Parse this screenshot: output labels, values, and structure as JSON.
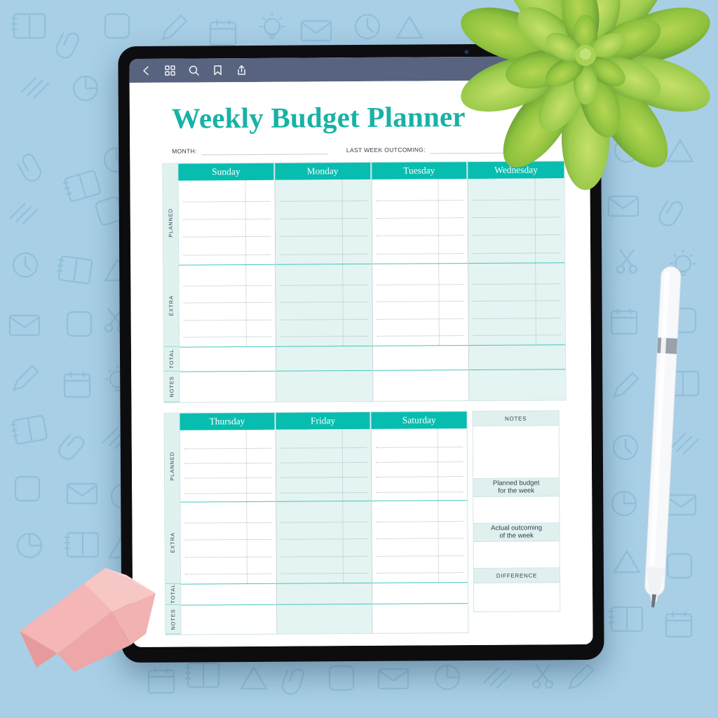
{
  "device": {
    "type": "tablet",
    "toolbar": {
      "icons": [
        {
          "name": "back-icon",
          "label": "Back"
        },
        {
          "name": "grid-icon",
          "label": "Thumbnails"
        },
        {
          "name": "search-icon",
          "label": "Search"
        },
        {
          "name": "bookmark-icon",
          "label": "Bookmark"
        },
        {
          "name": "share-icon",
          "label": "Share"
        },
        {
          "name": "undo-icon",
          "label": "Undo"
        }
      ],
      "background_color": "#58637F"
    }
  },
  "document": {
    "title": "Weekly Budget Planner",
    "title_color": "#17B2A6",
    "fields": [
      {
        "name": "month",
        "label": "MONTH:",
        "value": ""
      },
      {
        "name": "last-week-outcoming",
        "label": "LAST WEEK OUTCOMING:",
        "value": ""
      }
    ],
    "colors": {
      "header_teal": "#07BDAF",
      "tint_teal": "#E4F4F2",
      "label_band": "#DFF0EE",
      "rule_teal": "#45C6BD",
      "border": "#CFE3E3"
    },
    "row_labels": [
      "PLANNED",
      "EXTRA",
      "TOTAL",
      "NOTES"
    ],
    "planner_1": {
      "days": [
        "Sunday",
        "Monday",
        "Tuesday",
        "Wednesday"
      ]
    },
    "planner_2": {
      "days": [
        "Thursday",
        "Friday",
        "Saturday"
      ]
    },
    "notes_panel": {
      "title": "NOTES",
      "sections": [
        {
          "name": "planned-budget",
          "line1": "Planned budget",
          "line2": "for the week",
          "value": ""
        },
        {
          "name": "actual-outcoming",
          "line1": "Actual outcoming",
          "line2": "of the week",
          "value": ""
        },
        {
          "name": "difference",
          "line1": "DIFFERENCE",
          "line2": "",
          "value": ""
        }
      ]
    }
  }
}
